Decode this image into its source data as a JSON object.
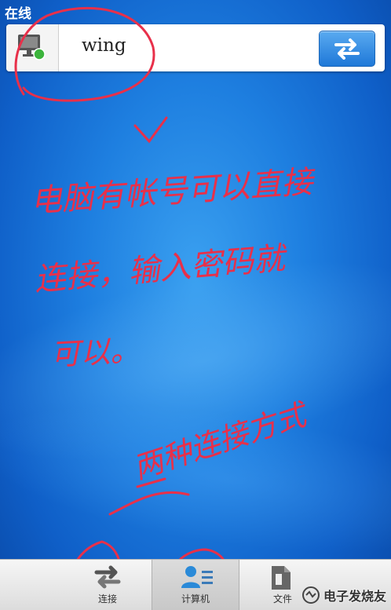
{
  "status": {
    "label": "在线"
  },
  "device": {
    "name": "wing",
    "icon": "monitor-icon",
    "online_color": "#3cb43c"
  },
  "swap_button": {
    "icon": "swap-arrows-icon"
  },
  "annotations": {
    "line1": "电脑有帐号可以直接",
    "line2": "连接，输入密码就",
    "line3": "可以。",
    "line4": "两种连接方式",
    "ink_color": "#e8304a"
  },
  "tabs": [
    {
      "label": "连接",
      "icon": "connect-arrows-icon"
    },
    {
      "label": "计算机",
      "icon": "contacts-icon"
    },
    {
      "label": "文件",
      "icon": "file-icon"
    }
  ],
  "watermark": {
    "text": "电子发烧友"
  }
}
